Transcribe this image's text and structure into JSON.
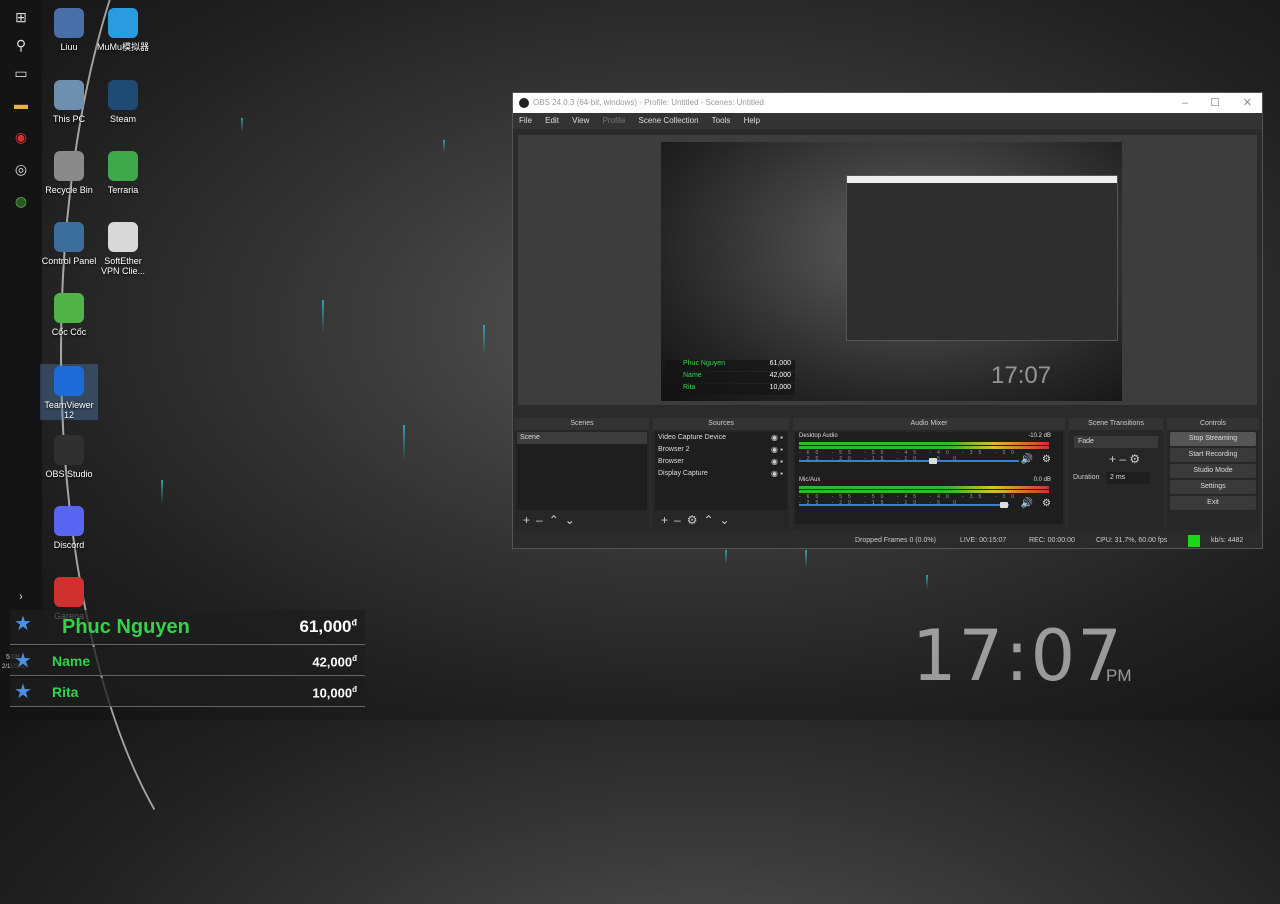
{
  "desktop": {
    "icons": [
      {
        "label": "Liuu",
        "icon": "user-folder-icon",
        "color": "#4a6ea8"
      },
      {
        "label": "MuMu模拟器",
        "icon": "mumu-player-icon",
        "color": "#2b9be0"
      },
      {
        "label": "This PC",
        "icon": "computer-icon",
        "color": "#6f8fae"
      },
      {
        "label": "Steam",
        "icon": "steam-icon",
        "color": "#1f4a74"
      },
      {
        "label": "Recycle Bin",
        "icon": "recycle-bin-icon",
        "color": "#8a8a8a"
      },
      {
        "label": "Terraria",
        "icon": "terraria-icon",
        "color": "#3fa84a"
      },
      {
        "label": "Control Panel",
        "icon": "control-panel-icon",
        "color": "#3b6e9a"
      },
      {
        "label": "SoftEther VPN Clie...",
        "icon": "softether-vpn-icon",
        "color": "#d8d8d8"
      },
      {
        "label": "Cốc Cốc",
        "icon": "coccoc-browser-icon",
        "color": "#52b448"
      },
      {
        "label": "TeamViewer 12",
        "icon": "teamviewer-icon",
        "color": "#1c6bd6"
      },
      {
        "label": "OBS Studio",
        "icon": "obs-studio-icon",
        "color": "#303030"
      },
      {
        "label": "Discord",
        "icon": "discord-icon",
        "color": "#5865f2"
      },
      {
        "label": "Garena",
        "icon": "garena-icon",
        "color": "#d03030"
      }
    ]
  },
  "taskbar": {
    "icons": [
      "windows-start-icon",
      "search-icon",
      "task-view-icon",
      "file-explorer-icon",
      "garena-icon",
      "obs-icon",
      "coccoc-icon"
    ],
    "time": "5:08",
    "date": "2/11/2020"
  },
  "donations": [
    {
      "name": "Phuc Nguyen",
      "amount": "61,000",
      "currency": "đ"
    },
    {
      "name": "Name",
      "amount": "42,000",
      "currency": "đ"
    },
    {
      "name": "Rita",
      "amount": "10,000",
      "currency": "đ"
    }
  ],
  "clock": {
    "time": "17:07",
    "ampm": "PM"
  },
  "obs": {
    "title": "OBS 24.0.3 (64-bit, windows) - Profile: Untitled - Scenes: Untitled",
    "menu": [
      "File",
      "Edit",
      "View",
      "Profile",
      "Scene Collection",
      "Tools",
      "Help"
    ],
    "docks": {
      "scenes": {
        "title": "Scenes",
        "items": [
          "Scene"
        ]
      },
      "sources": {
        "title": "Sources",
        "items": [
          "Video Capture Device",
          "Browser 2",
          "Browser",
          "Display Capture"
        ]
      },
      "mixer": {
        "title": "Audio Mixer",
        "channels": [
          {
            "name": "Desktop Audio",
            "db": "-10.2 dB",
            "level": 0.55,
            "volume": 0.72
          },
          {
            "name": "Mic/Aux",
            "db": "0.0 dB",
            "level": 0.5,
            "volume": 0.97
          }
        ],
        "ticks": "-60 -55 -50 -45 -40 -35 -30 -25 -20 -15 -10 -5 0"
      },
      "transitions": {
        "title": "Scene Transitions",
        "type": "Fade",
        "duration_label": "Duration",
        "duration": "2 ms"
      },
      "controls": {
        "title": "Controls",
        "buttons": [
          "Stop Streaming",
          "Start Recording",
          "Studio Mode",
          "Settings",
          "Exit"
        ]
      }
    },
    "status": {
      "dropped": "Dropped Frames 0 (0.0%)",
      "live": "LIVE: 00:15:07",
      "rec": "REC: 00:00:00",
      "cpu": "CPU: 31.7%, 60.00 fps",
      "kbps": "kb/s: 4482",
      "live_indicator_color": "#18d818"
    },
    "preview": {
      "clock": "17:07",
      "donations": [
        {
          "name": "Phuc Nguyen",
          "amount": "61,000"
        },
        {
          "name": "Name",
          "amount": "42,000"
        },
        {
          "name": "Rita",
          "amount": "10,000"
        }
      ]
    }
  }
}
